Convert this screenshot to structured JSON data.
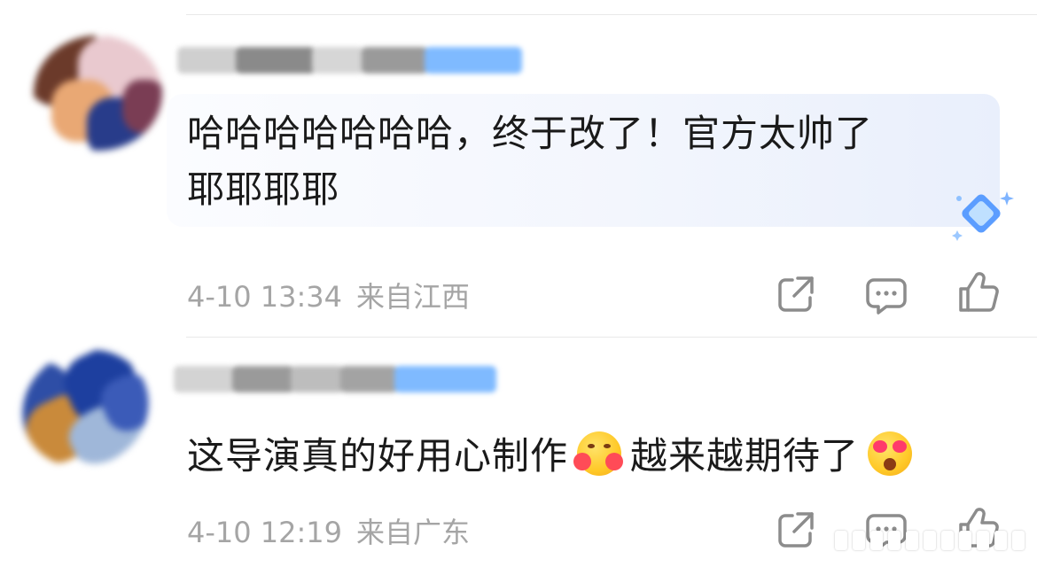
{
  "comments": [
    {
      "text_line1": "哈哈哈哈哈哈哈，终于改了！官方太帅了",
      "text_line2": "耶耶耶耶",
      "date": "4-10 13:34",
      "location": "来自江西",
      "has_badge": true
    },
    {
      "text_part1": "这导演真的好用心制作",
      "text_part2": "越来越期待了",
      "date": "4-10 12:19",
      "location": "来自广东",
      "emojis": [
        "hugging-face-emoji",
        "heart-eyes-emoji"
      ]
    }
  ],
  "icons": {
    "share": "share-icon",
    "comment": "comment-icon",
    "like": "thumbs-up-icon",
    "badge": "diamond-badge-icon"
  },
  "colors": {
    "text": "#1a1a1a",
    "meta": "#a5a5a5",
    "icon": "#8c8c8c",
    "name_blur_blue": "#6fb3ff"
  }
}
